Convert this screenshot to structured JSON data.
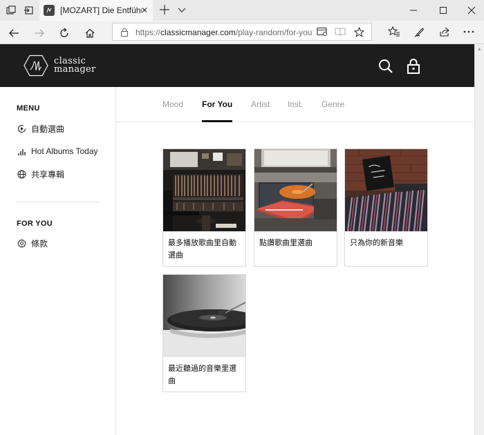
{
  "browser": {
    "tab_title": "[MOZART] Die Entführu",
    "url_prefix": "https://",
    "url_host": "classicmanager.com",
    "url_path": "/play-random/for-you"
  },
  "site": {
    "logo_line1": "classic",
    "logo_line2": "manager"
  },
  "sidebar": {
    "menu_title": "MENU",
    "menu_items": [
      {
        "label": "自動選曲",
        "icon": "play-circle-icon"
      },
      {
        "label": "Hot Albums Today",
        "icon": "bar-chart-icon"
      },
      {
        "label": "共享專輯",
        "icon": "globe-icon"
      }
    ],
    "foryou_title": "FOR YOU",
    "foryou_items": [
      {
        "label": "條款",
        "icon": "gear-icon"
      }
    ]
  },
  "main": {
    "tabs": [
      {
        "label": "Mood"
      },
      {
        "label": "For You",
        "active": true
      },
      {
        "label": "Artist"
      },
      {
        "label": "Inst."
      },
      {
        "label": "Genre"
      }
    ],
    "cards": [
      {
        "label": "最多播放歌曲里自動選曲"
      },
      {
        "label": "點讚歌曲里選曲"
      },
      {
        "label": "只為你的新音樂"
      },
      {
        "label": "最近聽過的音樂里選曲"
      }
    ]
  }
}
